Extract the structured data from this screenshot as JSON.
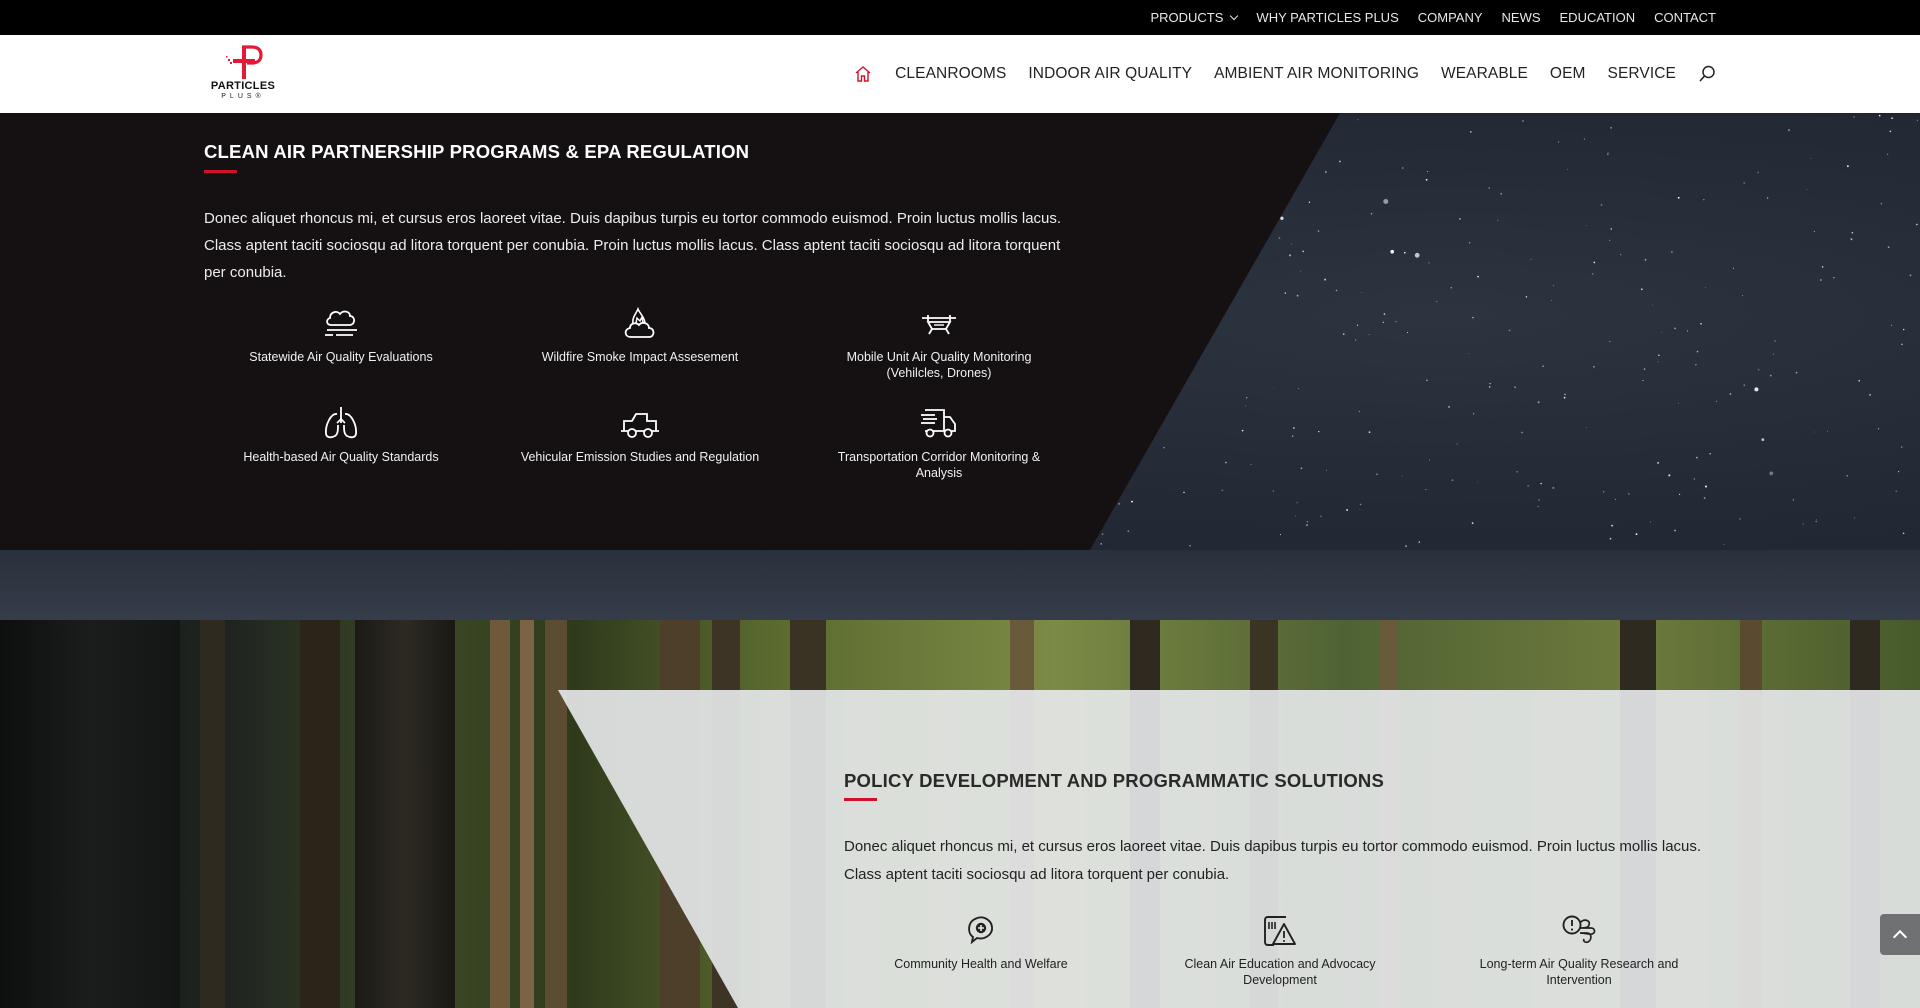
{
  "topbar": {
    "links": [
      {
        "label": "PRODUCTS",
        "has_dropdown": true
      },
      {
        "label": "WHY PARTICLES PLUS"
      },
      {
        "label": "COMPANY"
      },
      {
        "label": "NEWS"
      },
      {
        "label": "EDUCATION"
      },
      {
        "label": "CONTACT"
      }
    ]
  },
  "header": {
    "logo": {
      "name": "PARTICLES",
      "sub": "PLUS®"
    },
    "nav": [
      {
        "label": "CLEANROOMS"
      },
      {
        "label": "INDOOR AIR QUALITY"
      },
      {
        "label": "AMBIENT AIR MONITORING"
      },
      {
        "label": "WEARABLE"
      },
      {
        "label": "OEM"
      },
      {
        "label": "SERVICE"
      }
    ],
    "home_icon": "home-icon",
    "search_icon": "search-icon"
  },
  "section1": {
    "title": "CLEAN AIR PARTNERSHIP PROGRAMS & EPA REGULATION",
    "body": "Donec aliquet rhoncus mi, et cursus eros laoreet vitae. Duis dapibus turpis eu tortor commodo euismod. Proin luctus mollis lacus. Class aptent taciti sociosqu ad litora torquent per conubia. Proin luctus mollis lacus. Class aptent taciti sociosqu ad litora torquent per conubia.",
    "features": [
      {
        "label": "Statewide Air Quality Evaluations",
        "icon": "cloud-wind-icon"
      },
      {
        "label": "Wildfire Smoke Impact Assesement",
        "icon": "fire-smoke-icon"
      },
      {
        "label": "Mobile Unit Air Quality Monitoring (Vehilcles, Drones)",
        "icon": "drone-icon"
      },
      {
        "label": "Health-based Air Quality Standards",
        "icon": "lungs-icon"
      },
      {
        "label": "Vehicular Emission Studies and Regulation",
        "icon": "car-icon"
      },
      {
        "label": "Transportation Corridor Monitoring & Analysis",
        "icon": "delivery-truck-icon"
      }
    ]
  },
  "section2": {
    "title": "POLICY DEVELOPMENT AND PROGRAMMATIC SOLUTIONS",
    "body": "Donec aliquet rhoncus mi, et cursus eros laoreet vitae. Duis dapibus turpis eu tortor commodo euismod. Proin luctus mollis lacus. Class aptent taciti sociosqu ad litora torquent per conubia.",
    "features": [
      {
        "label": "Community Health and Welfare",
        "icon": "health-chat-icon"
      },
      {
        "label": "Clean Air Education and Advocacy Development",
        "icon": "warning-board-icon"
      },
      {
        "label": "Long-term Air Quality Research and Intervention",
        "icon": "alert-wind-icon"
      }
    ]
  },
  "colors": {
    "accent_red": "#d0112b",
    "topbar_bg": "#000000",
    "dark_panel": "#151113",
    "light_panel": "#e8eaec"
  },
  "back_to_top": {
    "icon": "chevron-up-icon"
  }
}
